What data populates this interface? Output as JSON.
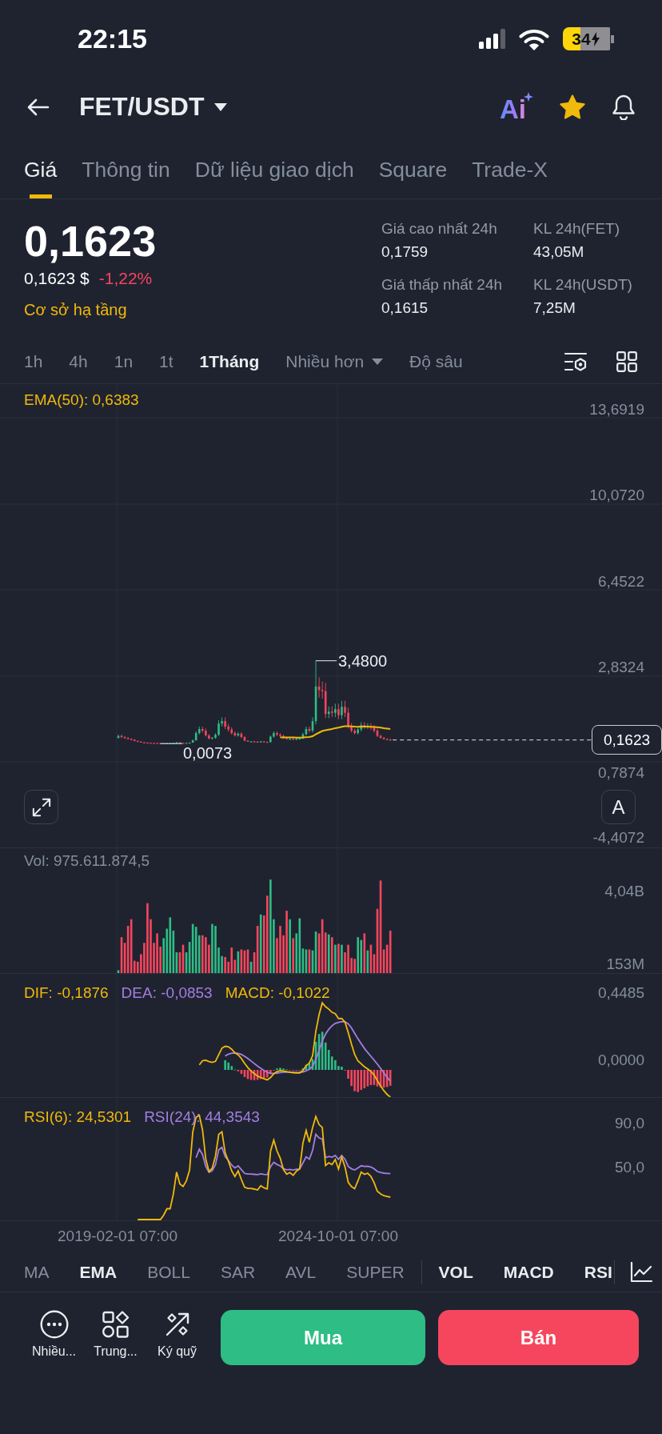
{
  "status_bar": {
    "time": "22:15",
    "battery": "34"
  },
  "header": {
    "pair": "FET/USDT",
    "ai_label": "Ai",
    "favorite": true
  },
  "tabs": [
    {
      "label": "Giá",
      "selected": true
    },
    {
      "label": "Thông tin",
      "selected": false
    },
    {
      "label": "Dữ liệu giao dịch",
      "selected": false
    },
    {
      "label": "Square",
      "selected": false
    },
    {
      "label": "Trade-X",
      "selected": false
    }
  ],
  "price": {
    "last": "0,1623",
    "fiat": "0,1623 $",
    "change": {
      "text": "-1,22%",
      "kind": "down"
    },
    "category": "Cơ sở hạ tầng"
  },
  "stats": [
    {
      "label": "Giá cao nhất 24h",
      "value": "0,1759"
    },
    {
      "label": "KL 24h(FET)",
      "value": "43,05M"
    },
    {
      "label": "Giá thấp nhất 24h",
      "value": "0,1615"
    },
    {
      "label": "KL 24h(USDT)",
      "value": "7,25M"
    }
  ],
  "timeframes": [
    {
      "label": "1h",
      "selected": false
    },
    {
      "label": "4h",
      "selected": false
    },
    {
      "label": "1n",
      "selected": false
    },
    {
      "label": "1t",
      "selected": false
    },
    {
      "label": "1Tháng",
      "selected": true
    }
  ],
  "more_menu": {
    "label": "Nhiều hơn"
  },
  "depth_tab": {
    "label": "Độ sâu",
    "selected": false
  },
  "chart": {
    "main": {
      "indicator_label": "EMA(50): 0,6383",
      "y_labels": [
        "13,6919",
        "10,0720",
        "6,4522",
        "2,8324",
        "0,7874",
        "-4,4072"
      ],
      "max_label": "3,4800",
      "min_label": "0,0073",
      "last_price": "0,1623",
      "auto_scale_label": "A"
    },
    "volume": {
      "label": "Vol: 975.611.874,5",
      "y_labels": [
        "4,04B",
        "153M"
      ]
    },
    "macd": {
      "values": [
        {
          "text": "DIF: -0,1876",
          "color": "#f0b90b"
        },
        {
          "text": "DEA: -0,0853",
          "color": "#a47ee0"
        },
        {
          "text": "MACD: -0,1022",
          "color": "#f0b90b"
        }
      ],
      "y_labels": [
        "0,4485",
        "0,0000"
      ]
    },
    "rsi": {
      "values": [
        {
          "text": "RSI(6): 24,5301",
          "color": "#f0b90b"
        },
        {
          "text": "RSI(24): 44,3543",
          "color": "#a47ee0"
        }
      ],
      "y_labels": [
        "90,0",
        "50,0"
      ]
    },
    "x_labels": [
      "2019-02-01 07:00",
      "2024-10-01 07:00"
    ]
  },
  "indicators": {
    "main": [
      {
        "label": "MA",
        "selected": false
      },
      {
        "label": "EMA",
        "selected": true
      },
      {
        "label": "BOLL",
        "selected": false
      },
      {
        "label": "SAR",
        "selected": false
      },
      {
        "label": "AVL",
        "selected": false
      },
      {
        "label": "SUPER",
        "selected": false
      }
    ],
    "sub": [
      {
        "label": "VOL",
        "selected": true
      },
      {
        "label": "MACD",
        "selected": true
      },
      {
        "label": "RSI",
        "selected": true
      }
    ]
  },
  "toolbar": [
    {
      "label": "Nhiều...",
      "kind": "more"
    },
    {
      "label": "Trung...",
      "kind": "hub"
    },
    {
      "label": "Ký quỹ",
      "kind": "margin"
    }
  ],
  "actions": [
    {
      "label": "Mua",
      "kind": "buy"
    },
    {
      "label": "Bán",
      "kind": "sell"
    }
  ]
}
